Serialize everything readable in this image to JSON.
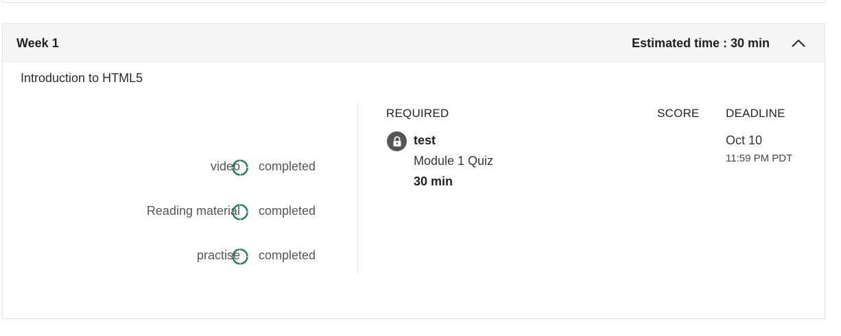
{
  "week": {
    "title": "Week 1",
    "estimated_time": "Estimated time : 30 min",
    "collapse_icon": "chevron-up-icon"
  },
  "module": {
    "title": "Introduction to HTML5",
    "progress": [
      {
        "label": "video",
        "status": "completed",
        "icon": "progress-ring-icon"
      },
      {
        "label": "Reading material",
        "status": "completed",
        "icon": "progress-ring-icon"
      },
      {
        "label": "practise",
        "status": "completed",
        "icon": "progress-ring-icon"
      }
    ]
  },
  "assessment": {
    "headers": {
      "required": "REQUIRED",
      "score": "SCORE",
      "deadline": "DEADLINE"
    },
    "item": {
      "name": "test",
      "subtitle": "Module 1 Quiz",
      "duration": "30 min",
      "lock_icon": "lock-icon",
      "score": "",
      "deadline_date": "Oct 10",
      "deadline_time": "11:59 PM PDT"
    }
  },
  "colors": {
    "accent_green": "#2a7f62",
    "header_bg": "#f5f5f5",
    "lock_bg": "#555555"
  }
}
